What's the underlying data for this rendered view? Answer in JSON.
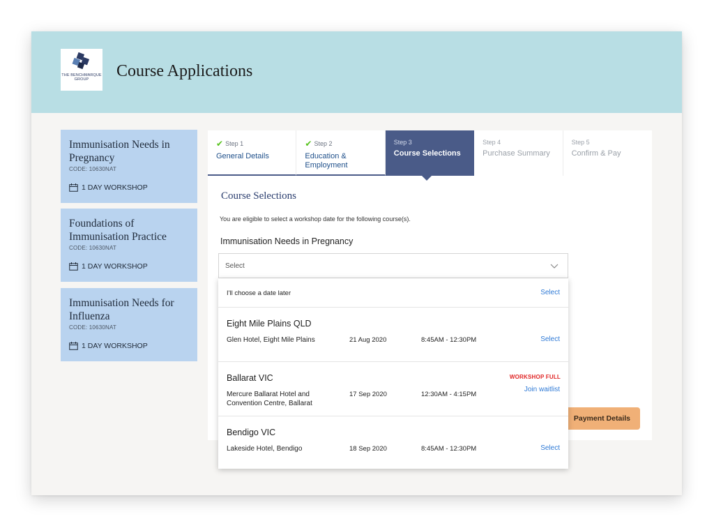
{
  "header": {
    "logo_text": "THE BENCHMARQUE GROUP",
    "title": "Course Applications"
  },
  "sidebar": {
    "courses": [
      {
        "name": "Immunisation Needs in Pregnancy",
        "code": "CODE: 10630NAT",
        "workshop": "1 DAY WORKSHOP"
      },
      {
        "name": "Foundations of Immunisation Practice",
        "code": "CODE: 10630NAT",
        "workshop": "1 DAY WORKSHOP"
      },
      {
        "name": "Immunisation Needs for Influenza",
        "code": "CODE: 10630NAT",
        "workshop": "1 DAY WORKSHOP"
      }
    ]
  },
  "steps": [
    {
      "num": "Step 1",
      "label": "General Details",
      "state": "done"
    },
    {
      "num": "Step 2",
      "label": "Education & Employment",
      "state": "done"
    },
    {
      "num": "Step 3",
      "label": "Course Selections",
      "state": "active"
    },
    {
      "num": "Step 4",
      "label": "Purchase Summary",
      "state": "pending"
    },
    {
      "num": "Step 5",
      "label": "Confirm & Pay",
      "state": "pending"
    }
  ],
  "main": {
    "section_title": "Course Selections",
    "eligibility_text": "You are eligible to select a workshop date for the following course(s).",
    "course_heading": "Immunisation Needs in Pregnancy",
    "select_placeholder": "Select",
    "payment_button": "Payment Details"
  },
  "dropdown": {
    "later": {
      "text": "I'll choose a date later",
      "action": "Select"
    },
    "venues": [
      {
        "city": "Eight Mile Plains QLD",
        "location": "Glen Hotel, Eight Mile Plains",
        "date": "21 Aug 2020",
        "time": "8:45AM - 12:30PM",
        "action": "Select",
        "status": ""
      },
      {
        "city": "Ballarat VIC",
        "location": "Mercure Ballarat Hotel and Convention Centre, Ballarat",
        "date": "17 Sep 2020",
        "time": "12:30AM - 4:15PM",
        "action": "Join waitlist",
        "status": "WORKSHOP FULL"
      },
      {
        "city": "Bendigo VIC",
        "location": "Lakeside Hotel, Bendigo",
        "date": "18 Sep 2020",
        "time": "8:45AM - 12:30PM",
        "action": "Select",
        "status": ""
      }
    ]
  },
  "colors": {
    "header_bg": "#b8dee4",
    "card_bg": "#b9d3ef",
    "active_step": "#4a5b88",
    "link": "#2f7ad6",
    "alert": "#e02424",
    "button": "#f0b077",
    "check": "#55c21b"
  }
}
